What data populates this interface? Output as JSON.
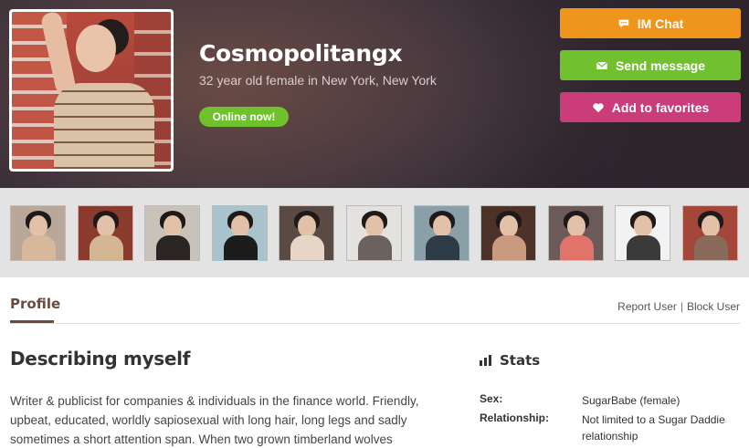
{
  "profile": {
    "username": "Cosmopolitangx",
    "subtitle": "32 year old female in New York, New York",
    "status_badge": "Online now!"
  },
  "actions": {
    "chat_label": "IM Chat",
    "message_label": "Send message",
    "favorite_label": "Add to favorites"
  },
  "icons": {
    "chat": "chat-bubble-icon",
    "message": "envelope-icon",
    "favorite": "heart-icon",
    "stats": "bar-chart-icon"
  },
  "colors": {
    "chat": "#f0951c",
    "message": "#71c030",
    "favorite": "#cb3c7b",
    "online": "#6fc12d",
    "tab_accent": "#6b4a3f"
  },
  "photos_count_visible": 11,
  "tabs": {
    "active": "Profile"
  },
  "user_links": {
    "report": "Report User",
    "separator": "|",
    "block": "Block User"
  },
  "about": {
    "title": "Describing myself",
    "text": "Writer & publicist for companies & individuals in the finance world. Friendly, upbeat, educated, worldly sapiosexual with long hair, long legs and sadly sometimes a short attention span. When two grown timberland wolves"
  },
  "stats": {
    "title": "Stats",
    "rows": [
      {
        "label": "Sex:",
        "value": "SugarBabe (female)"
      },
      {
        "label": "Relationship:",
        "value": "Not limited to a Sugar Daddie relationship"
      }
    ]
  }
}
